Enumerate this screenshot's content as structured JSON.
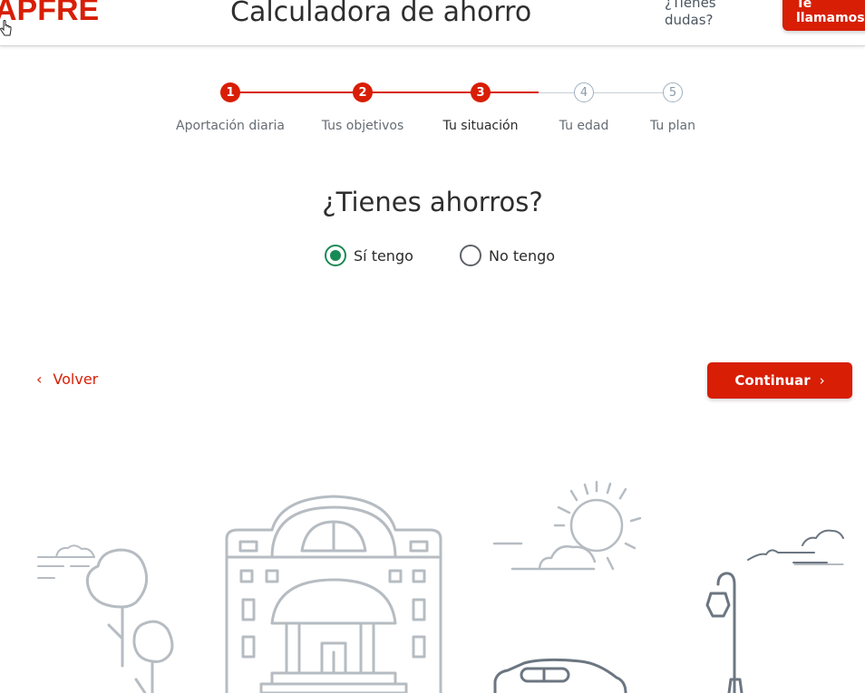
{
  "header": {
    "logo_text": "APFRE",
    "title": "Calculadora de ahorro",
    "help_text": "¿Tienes dudas?",
    "callback_button": "Te llamamos"
  },
  "stepper": {
    "steps": [
      {
        "number": "1",
        "label": "Aportación diaria",
        "state": "done"
      },
      {
        "number": "2",
        "label": "Tus objetivos",
        "state": "done"
      },
      {
        "number": "3",
        "label": "Tu situación",
        "state": "current"
      },
      {
        "number": "4",
        "label": "Tu edad",
        "state": "todo"
      },
      {
        "number": "5",
        "label": "Tu plan",
        "state": "todo"
      }
    ]
  },
  "question": {
    "title": "¿Tienes ahorros?",
    "options": [
      {
        "label": "Sí tengo",
        "selected": true
      },
      {
        "label": "No tengo",
        "selected": false
      }
    ]
  },
  "navigation": {
    "back_label": "Volver",
    "continue_label": "Continuar"
  },
  "colors": {
    "brand_red": "#d81e05",
    "radio_green": "#1a8a55",
    "illustration_gray": "#b6bcc2"
  },
  "icons": {
    "back": "chevron-left-icon",
    "continue": "chevron-right-icon",
    "cursor": "hand-pointer-icon"
  }
}
